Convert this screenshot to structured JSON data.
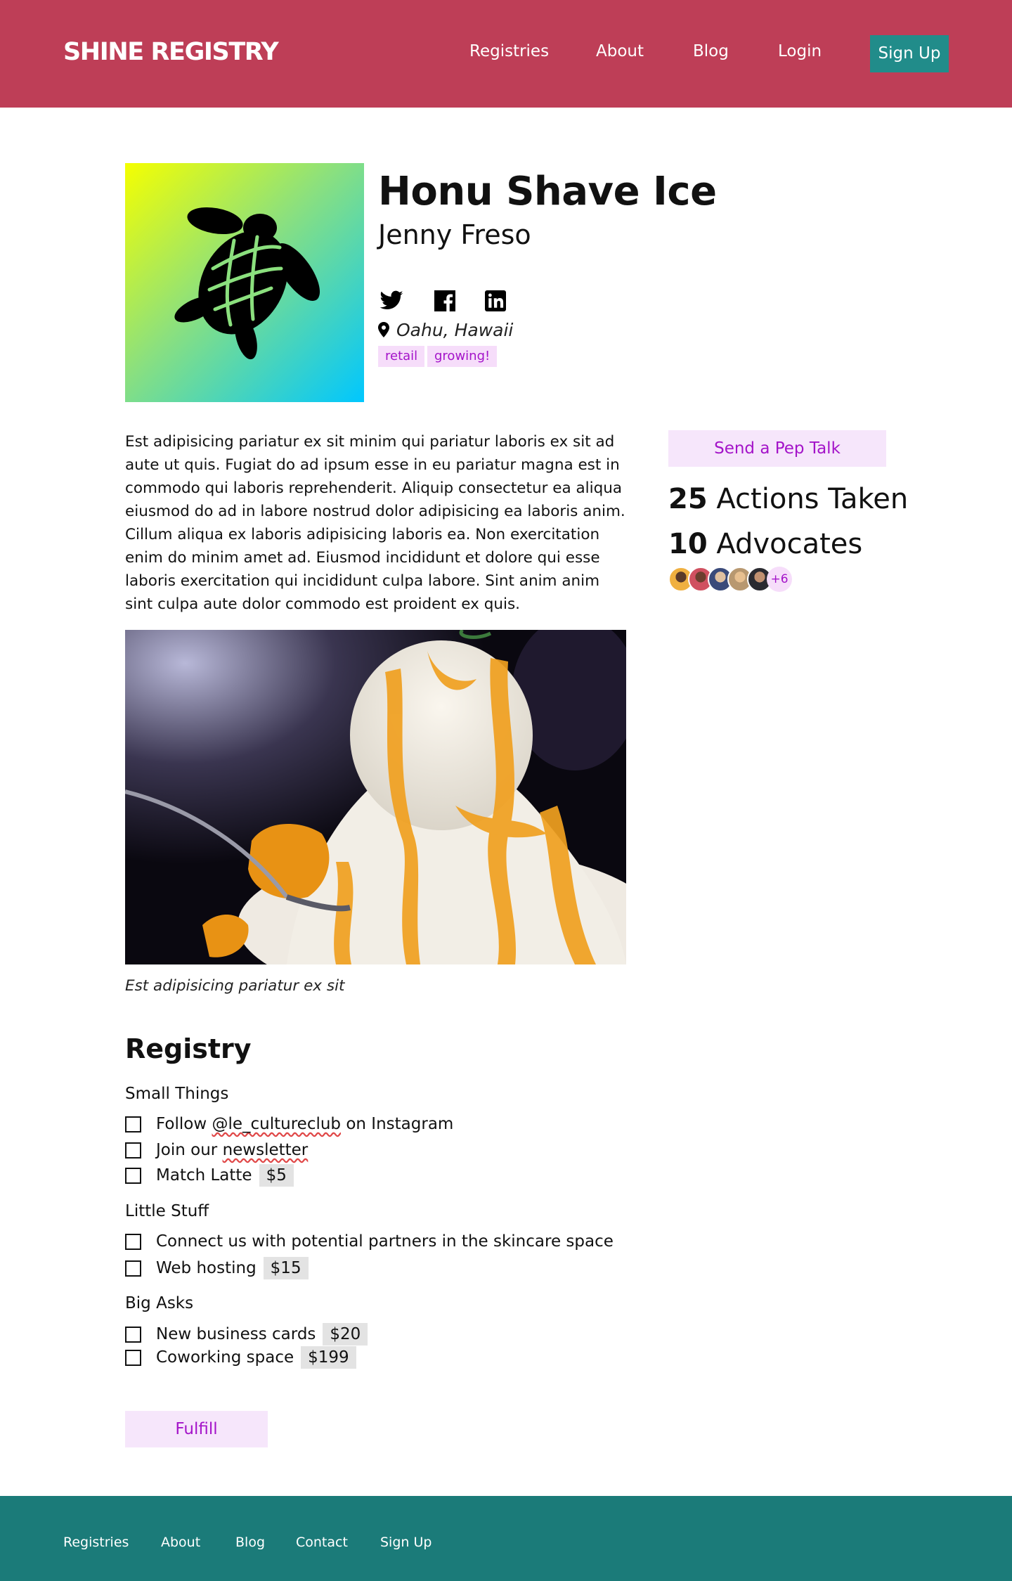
{
  "header": {
    "logo": "SHINE REGISTRY",
    "nav": [
      "Registries",
      "About",
      "Blog",
      "Login"
    ],
    "signup": "Sign Up",
    "bg_color": "#be3e57",
    "signup_color": "#218c8a"
  },
  "profile": {
    "image_icon": "sea-turtle-icon",
    "business_name": "Honu Shave Ice",
    "owner": "Jenny Freso",
    "social_icons": [
      "twitter-icon",
      "facebook-icon",
      "linkedin-icon"
    ],
    "location_icon": "map-pin-icon",
    "location": "Oahu, Hawaii",
    "tags": [
      "retail",
      "growing!"
    ]
  },
  "description": "Est adipisicing pariatur ex sit minim qui pariatur laboris ex sit ad aute ut quis. Fugiat do ad ipsum esse in eu pariatur magna est in commodo qui laboris reprehenderit. Aliquip consectetur ea aliqua eiusmod do ad in labore nostrud dolor adipisicing ea laboris anim. Cillum aliqua ex laboris adipisicing laboris ea. Non exercitation enim do minim amet ad. Eiusmod incididunt et dolore qui esse laboris exercitation qui incididunt culpa labore. Sint anim anim sint culpa aute dolor commodo est proident ex quis.",
  "photo_caption": "Est adipisicing pariatur ex sit",
  "sidebar": {
    "pep_talk": "Send a Pep Talk",
    "actions_count": "25",
    "actions_label": "Actions Taken",
    "advocates_count": "10",
    "advocates_label": "Advocates",
    "advocates_more": "+6"
  },
  "registry": {
    "title": "Registry",
    "groups": [
      {
        "title": "Small Things",
        "items": [
          {
            "pre": "Follow ",
            "link": "@le_cultureclub",
            "post": " on Instagram"
          },
          {
            "pre": "Join our ",
            "link": "newsletter",
            "post": ""
          },
          {
            "label": "Match Latte",
            "price": "$5"
          }
        ]
      },
      {
        "title": "Little Stuff",
        "items": [
          {
            "label": "Connect us with potential partners in the skincare space"
          },
          {
            "label": "Web hosting",
            "price": "$15"
          }
        ]
      },
      {
        "title": "Big Asks",
        "items": [
          {
            "label": "New business cards",
            "price": "$20"
          },
          {
            "label": "Coworking space",
            "price": "$199"
          }
        ]
      }
    ],
    "fulfill": "Fulfill"
  },
  "footer": {
    "links": [
      "Registries",
      "About",
      "Blog",
      "Contact",
      "Sign Up"
    ],
    "bg_color": "#1b7b79"
  },
  "accent_colors": {
    "purple_text": "#a414c9",
    "light_purple": "#f6e6fb"
  }
}
